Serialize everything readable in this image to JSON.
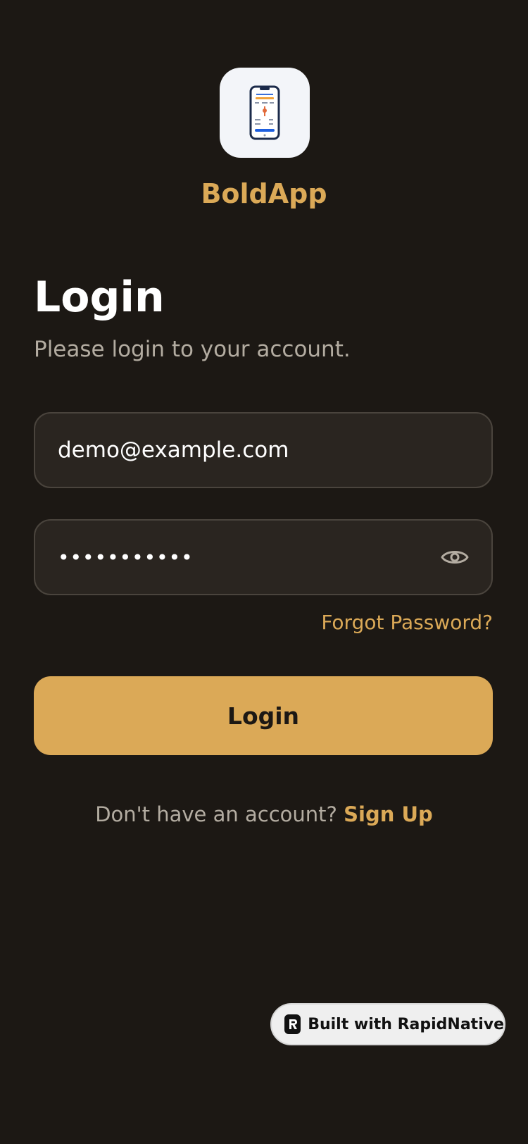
{
  "brand": {
    "name": "BoldApp",
    "icon": "phone-mockup-icon"
  },
  "header": {
    "title": "Login",
    "subtitle": "Please login to your account."
  },
  "form": {
    "email": {
      "value": "demo@example.com",
      "placeholder": ""
    },
    "password": {
      "value": "•••••••••••",
      "toggle_icon": "eye-icon"
    },
    "forgot_label": "Forgot Password?",
    "submit_label": "Login"
  },
  "signup": {
    "prompt": "Don't have an account?",
    "link": "Sign Up"
  },
  "badge": {
    "label": "Built with RapidNative",
    "icon": "rapidnative-logo-icon"
  },
  "colors": {
    "background": "#1c1814",
    "accent": "#dba957",
    "field_bg": "#2a2520",
    "field_border": "#4a443d",
    "muted_text": "#b3aca1"
  }
}
